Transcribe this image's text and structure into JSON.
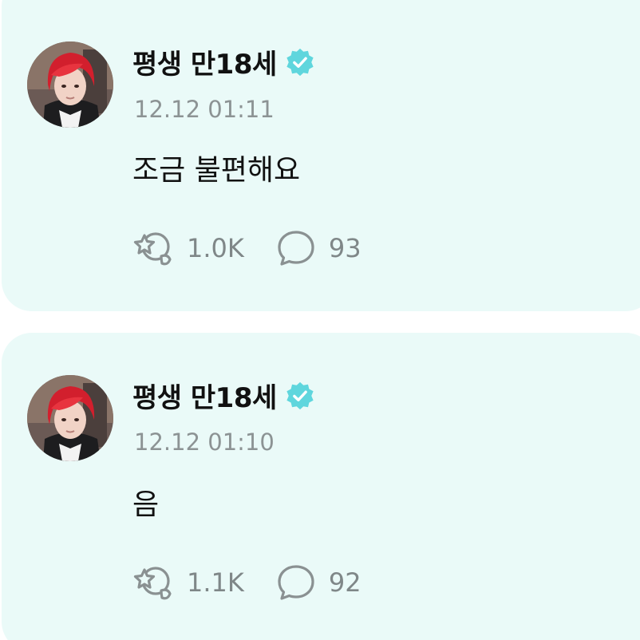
{
  "colors": {
    "card_background": "#eafaf8",
    "verified_badge": "#5fd6dd",
    "meta_text": "#8c9394",
    "icon_stroke": "#7f8788"
  },
  "posts": [
    {
      "author": "평생 만18세",
      "verified_icon": "verified-badge-icon",
      "timestamp": "12.12 01:11",
      "text": "조금 불편해요",
      "likes": "1.0K",
      "comments": "93",
      "like_icon": "reaction-icon",
      "comment_icon": "speech-bubble-icon"
    },
    {
      "author": "평생 만18세",
      "verified_icon": "verified-badge-icon",
      "timestamp": "12.12 01:10",
      "text": "음",
      "likes": "1.1K",
      "comments": "92",
      "like_icon": "reaction-icon",
      "comment_icon": "speech-bubble-icon"
    }
  ]
}
